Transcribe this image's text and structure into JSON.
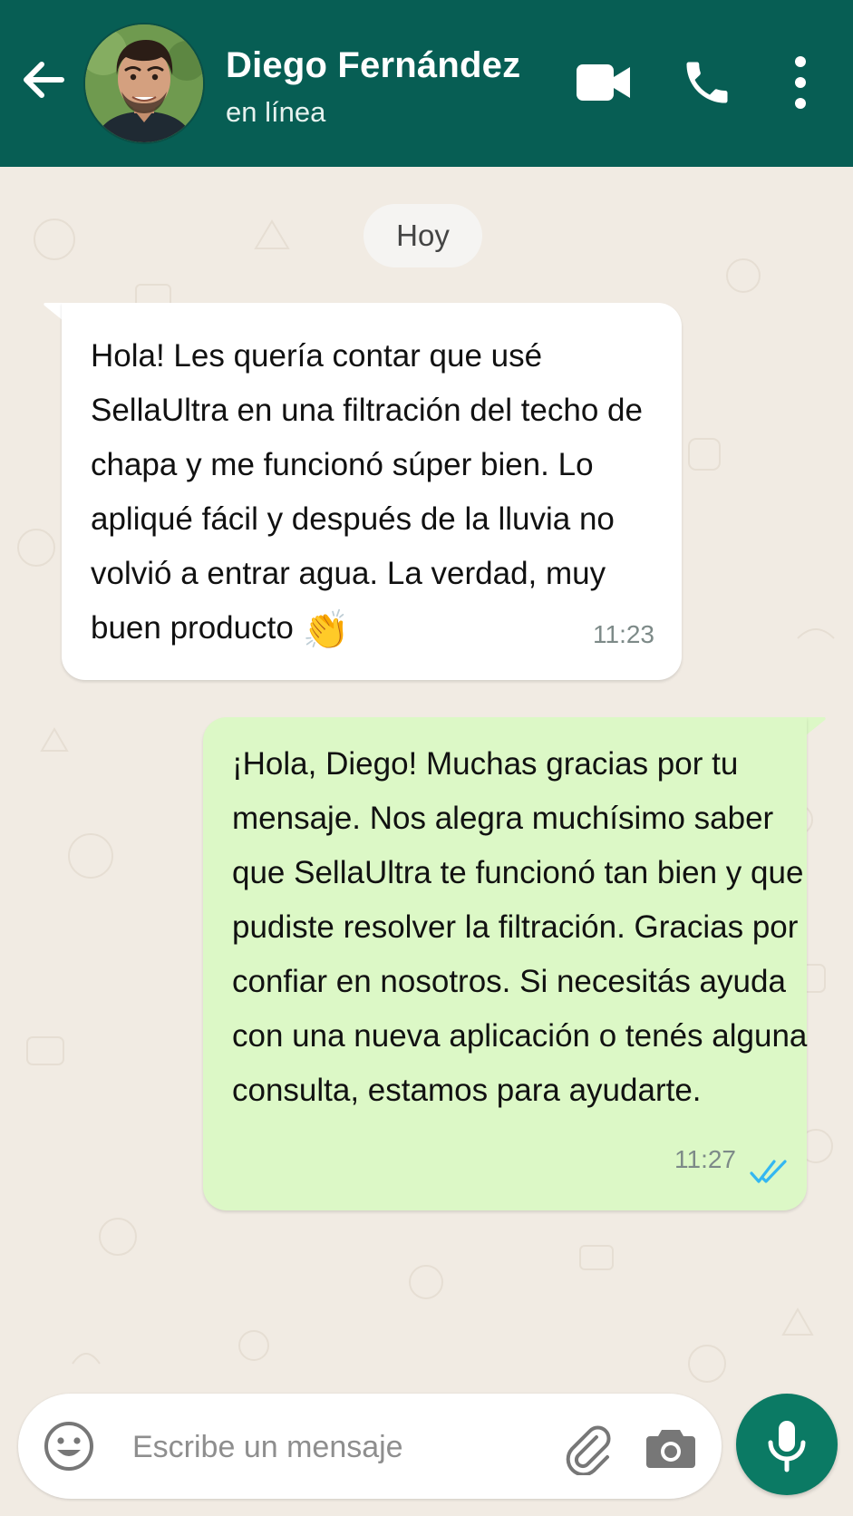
{
  "header": {
    "contact_name": "Diego Fernández",
    "status": "en línea",
    "background": "#075e54",
    "icons": [
      "back-arrow-icon",
      "video-call-icon",
      "voice-call-icon",
      "more-options-icon"
    ]
  },
  "chat": {
    "date_label": "Hoy",
    "messages": [
      {
        "direction": "incoming",
        "text": "Hola! Les quería contar que usé SellaUltra en una filtración del techo de chapa y me funcionó súper bien. Lo apliqué fácil y después de la lluvia no volvió a entrar agua. La verdad, muy buen producto",
        "emoji": "👏",
        "time": "11:23",
        "bubble_color": "#ffffff"
      },
      {
        "direction": "outgoing",
        "text": "¡Hola, Diego! Muchas gracias por tu mensaje. Nos alegra muchísimo saber que SellaUltra te funcionó tan bien y que pudiste resolver la filtración. Gracias por confiar en nosotros. Si necesitás ayuda con una nueva aplicación o tenés alguna consulta, estamos para ayudarte.",
        "time": "11:27",
        "status": "read",
        "bubble_color": "#dcf8c6",
        "tick_color": "#34b7f1"
      }
    ]
  },
  "composer": {
    "placeholder": "Escribe un mensaje",
    "value": "",
    "icons": [
      "emoji-icon",
      "paperclip-icon",
      "camera-icon",
      "microphone-icon"
    ],
    "mic_color": "#0b7a64"
  }
}
